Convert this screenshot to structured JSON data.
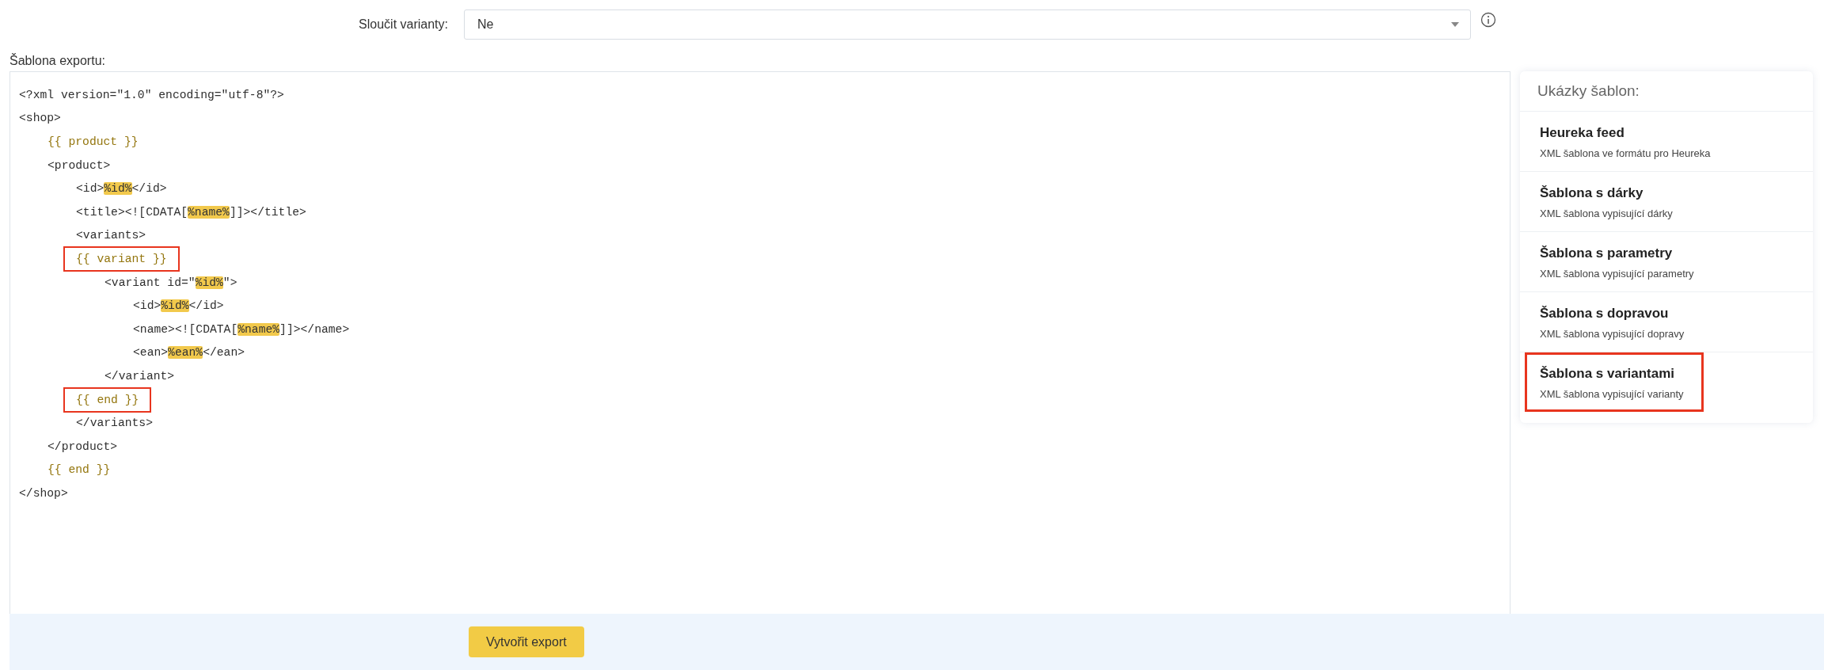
{
  "merge_variants": {
    "label": "Sloučit varianty:",
    "value": "Ne"
  },
  "template": {
    "label": "Šablona exportu:",
    "lines": [
      {
        "framed": false,
        "parts": [
          {
            "kind": "code",
            "text": "<?xml version=\"1.0\" encoding=\"utf-8\"?>"
          }
        ]
      },
      {
        "framed": false,
        "parts": [
          {
            "kind": "code",
            "text": "<shop>"
          }
        ],
        "children": [
          {
            "framed": false,
            "parts": [
              {
                "kind": "template",
                "text": "{{ product }}"
              }
            ]
          },
          {
            "framed": false,
            "parts": [
              {
                "kind": "code",
                "text": "<product>"
              }
            ],
            "children": [
              {
                "framed": false,
                "parts": [
                  {
                    "kind": "code",
                    "text": "<id>"
                  },
                  {
                    "kind": "placeholder",
                    "text": "%id%"
                  },
                  {
                    "kind": "code",
                    "text": "</id>"
                  }
                ]
              },
              {
                "framed": false,
                "parts": [
                  {
                    "kind": "code",
                    "text": "<title><![CDATA["
                  },
                  {
                    "kind": "placeholder",
                    "text": "%name%"
                  },
                  {
                    "kind": "code",
                    "text": "]]></title>"
                  }
                ]
              },
              {
                "framed": false,
                "parts": [
                  {
                    "kind": "code",
                    "text": "<variants>"
                  }
                ]
              },
              {
                "framed": true,
                "parts": [
                  {
                    "kind": "template",
                    "text": "{{ variant }}"
                  }
                ],
                "children": [
                  {
                    "framed": false,
                    "parts": [
                      {
                        "kind": "code",
                        "text": "<variant id=\""
                      },
                      {
                        "kind": "placeholder",
                        "text": "%id%"
                      },
                      {
                        "kind": "code",
                        "text": "\">"
                      }
                    ],
                    "children": [
                      {
                        "framed": false,
                        "parts": [
                          {
                            "kind": "code",
                            "text": "<id>"
                          },
                          {
                            "kind": "placeholder",
                            "text": "%id%"
                          },
                          {
                            "kind": "code",
                            "text": "</id>"
                          }
                        ]
                      },
                      {
                        "framed": false,
                        "parts": [
                          {
                            "kind": "code",
                            "text": "<name><![CDATA["
                          },
                          {
                            "kind": "placeholder",
                            "text": "%name%"
                          },
                          {
                            "kind": "code",
                            "text": "]]></name>"
                          }
                        ]
                      },
                      {
                        "framed": false,
                        "parts": [
                          {
                            "kind": "code",
                            "text": "<ean>"
                          },
                          {
                            "kind": "placeholder",
                            "text": "%ean%"
                          },
                          {
                            "kind": "code",
                            "text": "</ean>"
                          }
                        ]
                      }
                    ]
                  },
                  {
                    "framed": false,
                    "parts": [
                      {
                        "kind": "code",
                        "text": "</variant>"
                      }
                    ]
                  }
                ]
              },
              {
                "framed": true,
                "parts": [
                  {
                    "kind": "template",
                    "text": "{{ end }}"
                  }
                ]
              },
              {
                "framed": false,
                "parts": [
                  {
                    "kind": "code",
                    "text": "</variants>"
                  }
                ]
              }
            ]
          },
          {
            "framed": false,
            "parts": [
              {
                "kind": "code",
                "text": "</product>"
              }
            ]
          },
          {
            "framed": false,
            "parts": [
              {
                "kind": "template",
                "text": "{{ end }}"
              }
            ]
          }
        ]
      },
      {
        "framed": false,
        "parts": [
          {
            "kind": "code",
            "text": "</shop>"
          }
        ]
      }
    ]
  },
  "samples": {
    "title": "Ukázky šablon:",
    "items": [
      {
        "title": "Heureka feed",
        "description": "XML šablona ve formátu pro Heureka",
        "framed": false
      },
      {
        "title": "Šablona s dárky",
        "description": "XML šablona vypisující dárky",
        "framed": false
      },
      {
        "title": "Šablona s parametry",
        "description": "XML šablona vypisující parametry",
        "framed": false
      },
      {
        "title": "Šablona s dopravou",
        "description": "XML šablona vypisující dopravy",
        "framed": false
      },
      {
        "title": "Šablona s variantami",
        "description": "XML šablona vypisující varianty",
        "framed": true
      }
    ]
  },
  "submit_button": "Vytvořit export"
}
